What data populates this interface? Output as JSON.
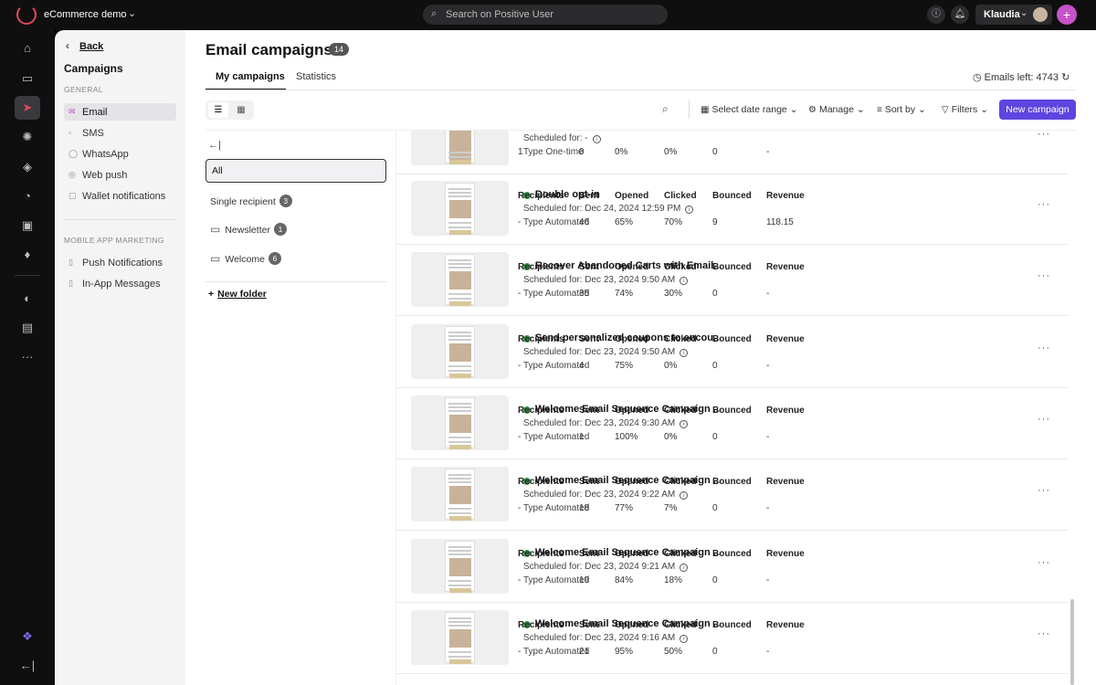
{
  "topbar": {
    "app_name": "eCommerce demo",
    "search_placeholder": "Search on Positive User",
    "user_name": "Klaudia",
    "plus_label": "+"
  },
  "rail": {
    "icons": [
      "home-icon",
      "inbox-icon",
      "campaigns-icon",
      "automation-icon",
      "layers-icon",
      "chart-icon",
      "browser-icon",
      "tag-icon",
      "contacts-icon",
      "chat-icon",
      "more-icon"
    ],
    "more_label": "···",
    "bottom_collapse_label": "←|",
    "accent": "#e0475b"
  },
  "campaign_nav": {
    "back_label": "Back",
    "title": "Campaigns",
    "general_section": "GENERAL",
    "general_items": [
      "Email",
      "SMS",
      "WhatsApp",
      "Web push",
      "Wallet notifications"
    ],
    "mobile_section": "MOBILE APP MARKETING",
    "mobile_items": [
      "Push Notifications",
      "In-App Messages"
    ]
  },
  "header": {
    "title": "Email campaigns",
    "count": "14",
    "tabs": [
      "My campaigns",
      "Statistics"
    ],
    "emails_left": "Emails left: 4743"
  },
  "toolbar": {
    "date_range": "Select date range",
    "manage": "Manage",
    "sort_by": "Sort by",
    "filters": "Filters",
    "new_campaign": "New campaign",
    "accent": "#5d45e0"
  },
  "folders": {
    "collapse_label": "←|",
    "all_label": "All",
    "items": [
      {
        "label": "Single recipient",
        "count": "3"
      },
      {
        "label": "Newsletter",
        "count": "1"
      },
      {
        "label": "Welcome",
        "count": "6"
      }
    ],
    "new_folder": "New folder"
  },
  "columns": [
    "Recipients",
    "Sent",
    "Opened",
    "Clicked",
    "Bounced",
    "Revenue"
  ],
  "campaigns": [
    {
      "name": "",
      "scheduled": "Scheduled for: -",
      "type": "Type One-time",
      "recipients": "1",
      "sent": "0",
      "opened": "0%",
      "clicked": "0%",
      "bounced": "0",
      "revenue": "-"
    },
    {
      "name": "Double opt-in",
      "scheduled": "Scheduled for: Dec 24, 2024 12:59 PM",
      "type": "Type Automated",
      "recipients": "-",
      "sent": "46",
      "opened": "65%",
      "clicked": "70%",
      "bounced": "9",
      "revenue": "118.15"
    },
    {
      "name": "Recover Abandoned Carts with Email...",
      "scheduled": "Scheduled for: Dec 23, 2024 9:50 AM",
      "type": "Type Automated",
      "recipients": "-",
      "sent": "35",
      "opened": "74%",
      "clicked": "30%",
      "bounced": "0",
      "revenue": "-"
    },
    {
      "name": "Send personalized coupons to encou...",
      "scheduled": "Scheduled for: Dec 23, 2024 9:50 AM",
      "type": "Type Automated",
      "recipients": "-",
      "sent": "4",
      "opened": "75%",
      "clicked": "0%",
      "bounced": "0",
      "revenue": "-"
    },
    {
      "name": "Welcome Email Sequence Campaign ...",
      "scheduled": "Scheduled for: Dec 23, 2024 9:30 AM",
      "type": "Type Automated",
      "recipients": "-",
      "sent": "1",
      "opened": "100%",
      "clicked": "0%",
      "bounced": "0",
      "revenue": "-"
    },
    {
      "name": "Welcome Email Sequence Campaign ...",
      "scheduled": "Scheduled for: Dec 23, 2024 9:22 AM",
      "type": "Type Automated",
      "recipients": "-",
      "sent": "18",
      "opened": "77%",
      "clicked": "7%",
      "bounced": "0",
      "revenue": "-"
    },
    {
      "name": "Welcome Email Sequence Campaign ...",
      "scheduled": "Scheduled for: Dec 23, 2024 9:21 AM",
      "type": "Type Automated",
      "recipients": "-",
      "sent": "19",
      "opened": "84%",
      "clicked": "18%",
      "bounced": "0",
      "revenue": "-"
    },
    {
      "name": "Welcome Email Sequence Campaign ...",
      "scheduled": "Scheduled for: Dec 23, 2024 9:16 AM",
      "type": "Type Automated",
      "recipients": "-",
      "sent": "21",
      "opened": "95%",
      "clicked": "50%",
      "bounced": "0",
      "revenue": "-"
    }
  ],
  "status_color": "#3a9d4b"
}
